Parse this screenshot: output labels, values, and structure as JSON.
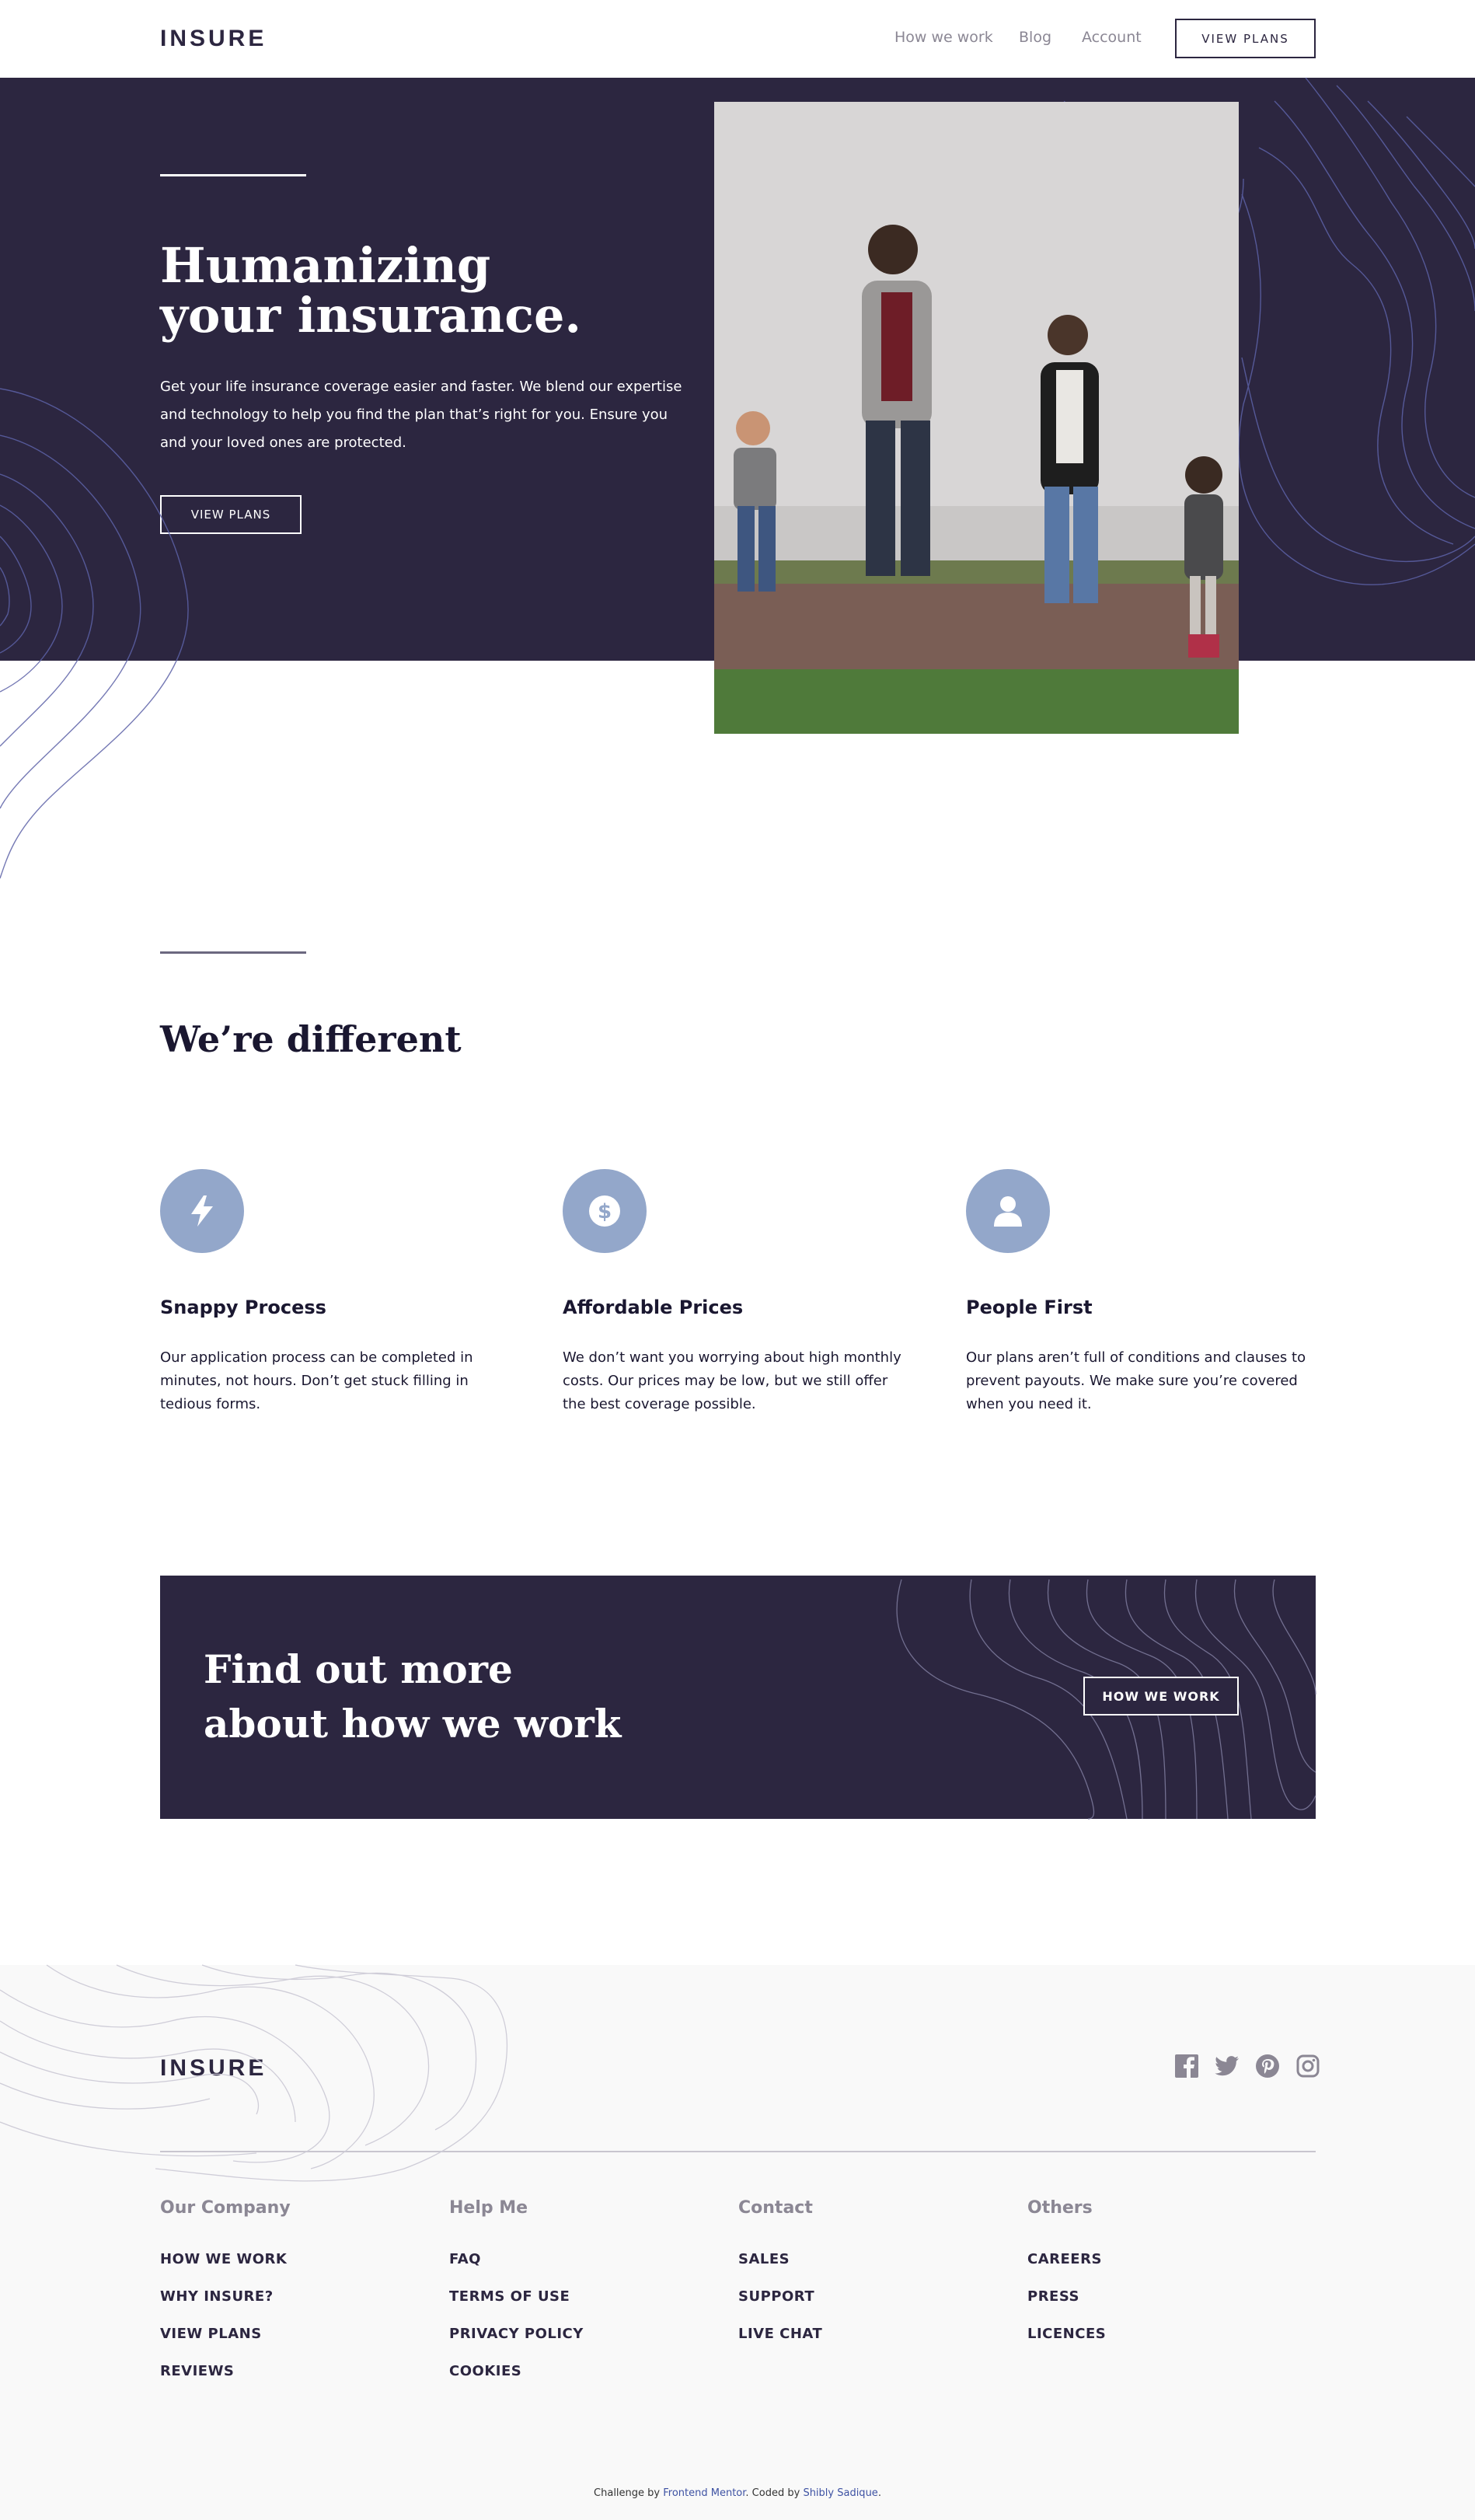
{
  "header": {
    "logo": "INSURE",
    "nav": [
      "How we work",
      "Blog",
      "Account"
    ],
    "cta": "VIEW PLANS"
  },
  "hero": {
    "title_line1": "Humanizing",
    "title_line2": "your insurance.",
    "text": "Get your life insurance coverage easier and faster. We blend our expertise and technology to help you find the plan that’s right for you. Ensure you and your loved ones are protected.",
    "cta": "VIEW PLANS"
  },
  "different": {
    "title": "We’re different",
    "features": [
      {
        "icon": "lightning-icon",
        "title": "Snappy Process",
        "text": "Our application process can be completed in minutes, not hours. Don’t get stuck filling in tedious forms."
      },
      {
        "icon": "dollar-icon",
        "title": "Affordable Prices",
        "text": "We don’t want you worrying about high monthly costs. Our prices may be low, but we still offer the best coverage possible."
      },
      {
        "icon": "person-icon",
        "title": "People First",
        "text": "Our plans aren’t full of conditions and clauses to prevent payouts. We make sure you’re covered when you need it."
      }
    ]
  },
  "cta_banner": {
    "line1": "Find out more",
    "line2": "about how we work",
    "button": "HOW WE WORK"
  },
  "footer": {
    "logo": "INSURE",
    "socials": [
      "facebook-icon",
      "twitter-icon",
      "pinterest-icon",
      "instagram-icon"
    ],
    "columns": [
      {
        "title": "Our Company",
        "links": [
          "HOW WE WORK",
          "WHY INSURE?",
          "VIEW PLANS",
          "REVIEWS"
        ]
      },
      {
        "title": "Help Me",
        "links": [
          "FAQ",
          "TERMS OF USE",
          "PRIVACY POLICY",
          "COOKIES"
        ]
      },
      {
        "title": "Contact",
        "links": [
          "SALES",
          "SUPPORT",
          "LIVE CHAT"
        ]
      },
      {
        "title": "Others",
        "links": [
          "CAREERS",
          "PRESS",
          "LICENCES"
        ]
      }
    ],
    "attribution": {
      "prefix": "Challenge by ",
      "link1": "Frontend Mentor",
      "middle": ". Coded by ",
      "link2": "Shibly Sadique",
      "suffix": "."
    }
  },
  "colors": {
    "dark_violet": "#2c2640",
    "icon_blue": "#93a7ca",
    "grey": "#8b8794",
    "footer_bg": "#f9f9f9"
  }
}
